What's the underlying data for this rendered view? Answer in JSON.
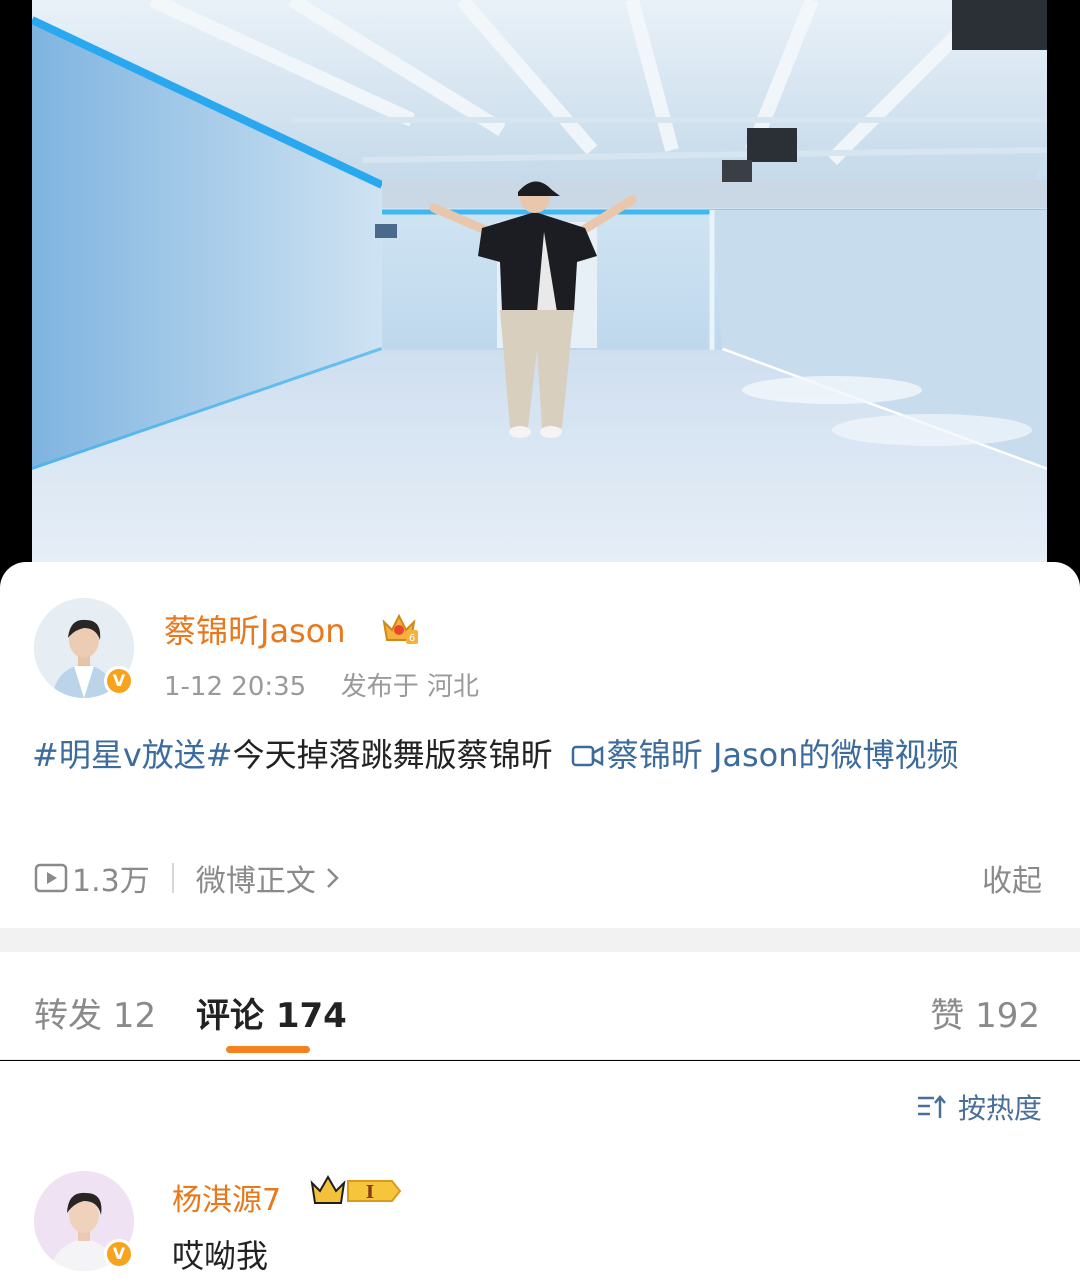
{
  "post": {
    "username": "蔡锦昕Jason",
    "time": "1-12 20:35",
    "location": "发布于 河北",
    "topic": "#明星v放送#",
    "text": "今天掉落跳舞版蔡锦昕",
    "video_link": "蔡锦昕 Jason的微博视频",
    "views": "1.3万",
    "full_text_link": "微博正文",
    "collapse": "收起",
    "verified_mark": "V"
  },
  "tabs": {
    "repost_label": "转发",
    "repost_count": "12",
    "comment_label": "评论",
    "comment_count": "174",
    "like_label": "赞",
    "like_count": "192"
  },
  "comments": {
    "sort_label": "按热度",
    "items": [
      {
        "username": "杨淇源7",
        "text": "哎呦我",
        "badge_level": "I"
      }
    ]
  },
  "colors": {
    "username": "#e9781c",
    "topic": "#3c6b9c",
    "tab_indicator": "#f5821f",
    "verified": "#f8a31c"
  },
  "icons": [
    "play-count-icon",
    "chevron-right-icon",
    "video-link-icon",
    "sort-icon",
    "crown-badge-icon",
    "verified-icon"
  ]
}
